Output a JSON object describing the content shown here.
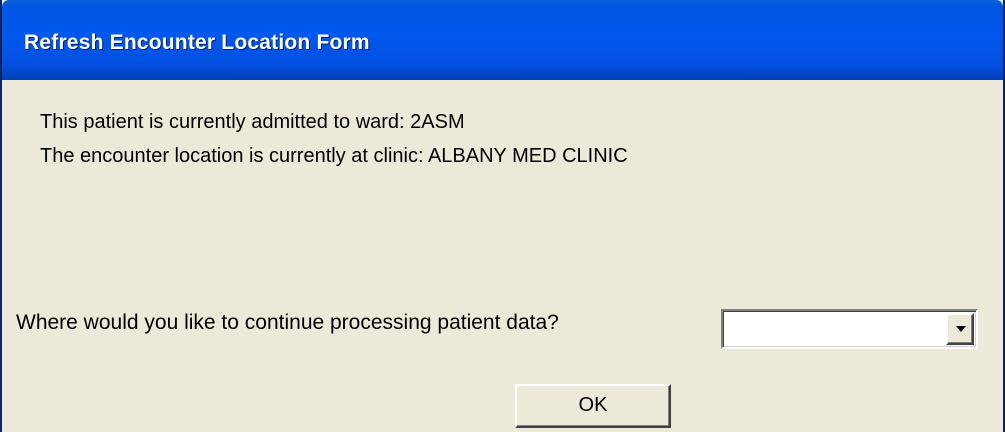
{
  "window": {
    "title": "Refresh Encounter Location Form"
  },
  "message": {
    "line1": "This patient is currently admitted to ward: 2ASM",
    "line2": "The encounter location is currently at clinic: ALBANY MED CLINIC"
  },
  "prompt": {
    "question": "Where would you like to continue processing patient data?",
    "selected_value": ""
  },
  "buttons": {
    "ok_label": "OK"
  },
  "colors": {
    "titlebar": "#0058ee",
    "window_bg": "#ece9d8"
  }
}
